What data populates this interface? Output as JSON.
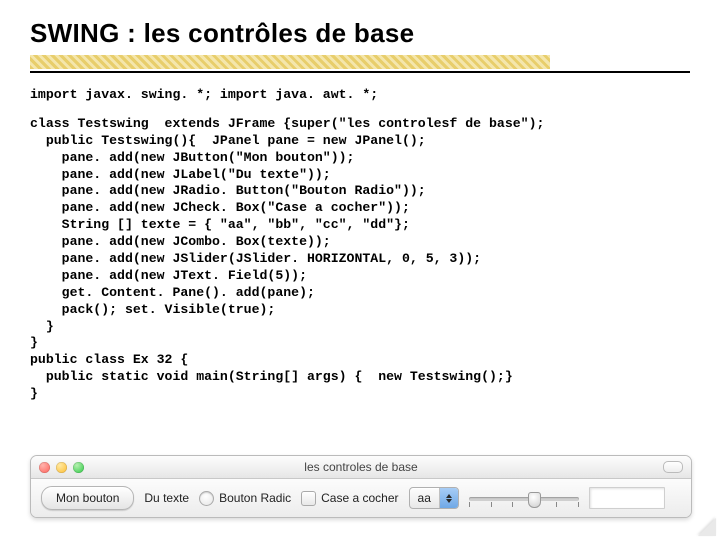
{
  "title": "SWING : les contrôles de base",
  "code_imports": "import javax. swing. *; import java. awt. *;",
  "code_body": "class Testswing  extends JFrame {super(\"les controlesf de base\");\n  public Testswing(){  JPanel pane = new JPanel();\n    pane. add(new JButton(\"Mon bouton\"));\n    pane. add(new JLabel(\"Du texte\"));\n    pane. add(new JRadio. Button(\"Bouton Radio\"));\n    pane. add(new JCheck. Box(\"Case a cocher\"));\n    String [] texte = { \"aa\", \"bb\", \"cc\", \"dd\"};\n    pane. add(new JCombo. Box(texte));\n    pane. add(new JSlider(JSlider. HORIZONTAL, 0, 5, 3));\n    pane. add(new JText. Field(5));\n    get. Content. Pane(). add(pane);\n    pack(); set. Visible(true);\n  }\n}\npublic class Ex 32 {\n  public static void main(String[] args) {  new Testswing();}\n}",
  "window": {
    "title": "les controles de base",
    "button_label": "Mon bouton",
    "static_text": "Du texte",
    "radio_label": "Bouton Radic",
    "checkbox_label": "Case a cocher",
    "combo_selected": "aa",
    "slider": {
      "min": 0,
      "max": 5,
      "value": 3
    }
  }
}
